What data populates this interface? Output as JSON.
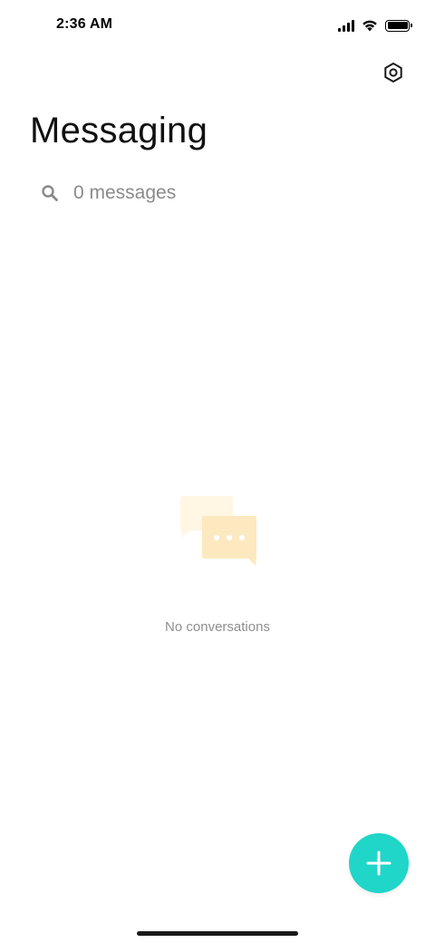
{
  "status_bar": {
    "time": "2:36 AM",
    "icons": [
      "signal-icon",
      "wifi-icon",
      "battery-icon"
    ]
  },
  "header": {
    "settings_icon": "settings-hexagon-icon",
    "title": "Messaging"
  },
  "search": {
    "icon": "search-icon",
    "placeholder": "0 messages"
  },
  "empty_state": {
    "illustration": "chat-bubbles-icon",
    "text": "No conversations"
  },
  "fab": {
    "icon": "plus-icon",
    "color": "#1fd6c8"
  },
  "colors": {
    "accent": "#1fd6c8",
    "bubble_back": "#fff6e3",
    "bubble_front": "#fde9c0"
  }
}
